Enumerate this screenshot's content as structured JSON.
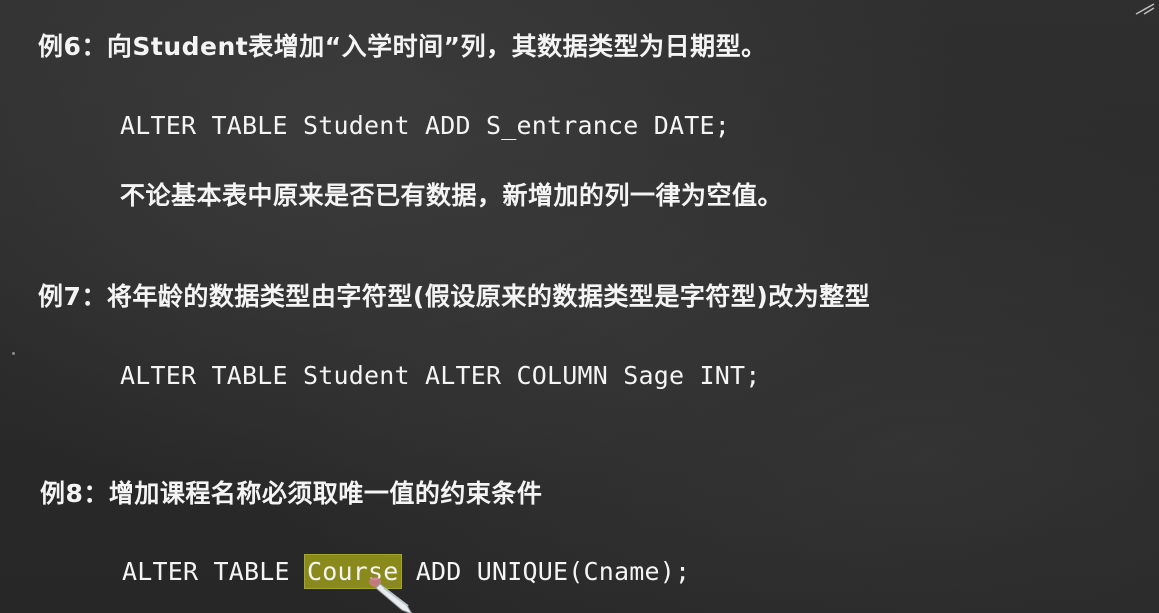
{
  "slide": {
    "examples": [
      {
        "heading": "例6：向Student表增加“入学时间”列，其数据类型为日期型。",
        "code_before": "ALTER TABLE Student ADD S_entrance DATE;",
        "note": "不论基本表中原来是否已有数据，新增加的列一律为空值。"
      },
      {
        "heading": "例7：将年龄的数据类型由字符型(假设原来的数据类型是字符型)改为整型",
        "code_before": "ALTER TABLE Student ALTER COLUMN Sage INT;"
      },
      {
        "heading": "例8：增加课程名称必须取唯一值的约束条件",
        "code_before": "ALTER TABLE ",
        "code_highlight": "Course",
        "code_after": " ADD UNIQUE(Cname);"
      }
    ]
  },
  "colors": {
    "background": "#2b2b2b",
    "text": "#f4f4f4",
    "highlight": "#8a8a1c"
  },
  "icons": {
    "cursor": "pen-cursor-icon",
    "corner": "window-corner-icon"
  }
}
